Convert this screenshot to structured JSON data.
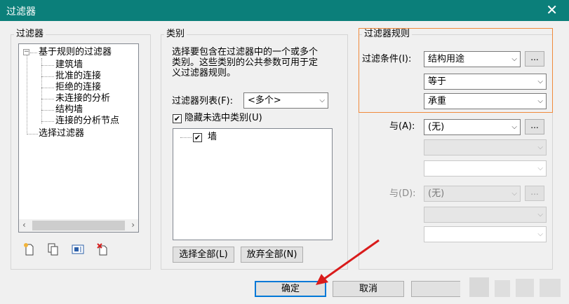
{
  "window": {
    "title": "过滤器",
    "close_glyph": "✕"
  },
  "filters_panel": {
    "title": "过滤器",
    "tree_root": "基于规则的过滤器",
    "tree_root_expander": "−",
    "tree_children": [
      "建筑墙",
      "批准的连接",
      "拒绝的连接",
      "未连接的分析",
      "结构墙",
      "连接的分析节点"
    ],
    "tree_selection": "选择过滤器",
    "scroll_left": "‹",
    "scroll_right": "›",
    "toolbar_icons": [
      "new-filter-icon",
      "duplicate-filter-icon",
      "rename-filter-icon",
      "delete-filter-icon"
    ]
  },
  "categories_panel": {
    "title": "类别",
    "description_lines": [
      "选择要包含在过滤器中的一个或多个",
      "类别。这些类别的公共参数可用于定",
      "义过滤器规则。"
    ],
    "filter_list_label": "过滤器列表(F):",
    "filter_list_value": "<多个>",
    "hide_unchecked_label": "隐藏未选中类别(U)",
    "hide_unchecked_checked": "✔",
    "list_items": [
      {
        "label": "墙",
        "checked": "✔"
      }
    ],
    "select_all_label": "选择全部(L)",
    "deselect_all_label": "放弃全部(N)"
  },
  "rules_panel": {
    "title": "过滤器规则",
    "condition_label": "过滤条件(I):",
    "condition_value": "结构用途",
    "operator_value": "等于",
    "value_value": "承重",
    "and_a_label": "与(A):",
    "and_a_value": "(无)",
    "and_d_label": "与(D):",
    "and_d_value": "(无)",
    "dots_label": "...",
    "arrow_glyph": "⌵"
  },
  "footer": {
    "ok_label": "确定",
    "cancel_label": "取消"
  }
}
